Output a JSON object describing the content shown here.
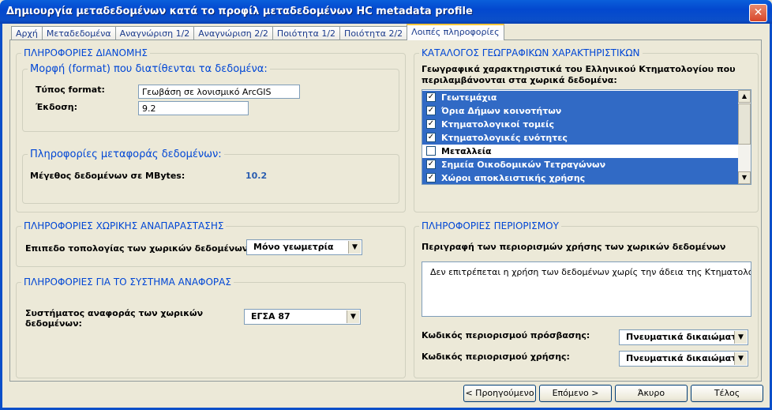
{
  "window": {
    "title": "Δημιουργία μεταδεδομένων κατά το προφίλ μεταδεδομένων HC metadata profile",
    "close": "✕"
  },
  "tabs": [
    "Αρχή",
    "Μεταδεδομένα",
    "Αναγνώριση 1/2",
    "Αναγνώριση 2/2",
    "Ποιότητα 1/2",
    "Ποιότητα 2/2",
    "Λοιπές πληροφορίες"
  ],
  "distribution": {
    "title": "ΠΛΗΡΟΦΟΡΙΕΣ ΔΙΑΝΟΜΗΣ",
    "format_group": "Μορφή (format) που διατίθενται τα δεδομένα:",
    "format_type_label": "Τύπος  format:",
    "format_type_value": "Γεωβάση σε λονισμικό ArcGIS",
    "version_label": "Έκδοση:",
    "version_value": "9.2",
    "transfer_group": "Πληροφορίες μεταφοράς δεδομένων:",
    "size_label": "Μέγεθος δεδομένων σε MBytes:",
    "size_value": "10.2"
  },
  "spatial": {
    "title": "ΠΛΗΡΟΦΟΡΙΕΣ ΧΩΡΙΚΗΣ ΑΝΑΠΑΡΑΣΤΑΣΗΣ",
    "topology_label": "Επιπεδο τοπολογίας των χωρικών δεδομένων:",
    "topology_value": "Μόνο γεωμετρία"
  },
  "reference": {
    "title": "ΠΛΗΡΟΦΟΡΙΕΣ ΓΙΑ ΤΟ ΣΥΣΤΗΜΑ ΑΝΑΦΟΡΑΣ",
    "system_label_1": "Συστήματος αναφοράς των χωρικών",
    "system_label_2": "δεδομένων:",
    "system_value": "ΕΓΣΑ 87"
  },
  "catalog": {
    "title": "ΚΑΤΑΛΟΓΟΣ ΓΕΩΓΡΑΦΙΚΩΝ ΧΑΡΑΚΤΗΡΙΣΤΙΚΩΝ",
    "description_1": "Γεωγραφικά χαρακτηριστικά του Ελληνικού Κτηματολογίου που",
    "description_2": "περιλαμβάνονται στα χωρικά δεδομένα:",
    "items": [
      {
        "label": "Γεωτεμάχια",
        "checked": "✓",
        "selected": true
      },
      {
        "label": "Όρια Δήμων κοινοτήτων",
        "checked": "✓",
        "selected": true
      },
      {
        "label": "Κτηματολογικοί τομείς",
        "checked": "✓",
        "selected": true
      },
      {
        "label": "Κτηματολογικές ενότητες",
        "checked": "✓",
        "selected": true
      },
      {
        "label": "Μεταλλεία",
        "checked": "",
        "selected": false
      },
      {
        "label": "Σημεία Οικοδομικών Τετραγώνων",
        "checked": "✓",
        "selected": true
      },
      {
        "label": "Χώροι αποκλειστικής χρήσης",
        "checked": "✓",
        "selected": true
      }
    ]
  },
  "restrictions": {
    "title": "ΠΛΗΡΟΦΟΡΙΕΣ ΠΕΡΙΟΡΙΣΜΟΥ",
    "description_label": "Περιγραφή των περιορισμών χρήσης των χωρικών δεδομένων",
    "description_value": "Δεν επιτρέπεται η χρήση των δεδομένων χωρίς την άδεια της Κτηματολόγιο Α.Ε",
    "access_label": "Κωδικός περιορισμού πρόσβασης:",
    "access_value": "Πνευματικά δικαιώματα",
    "use_label": "Κωδικός περιορισμού χρήσης:",
    "use_value": "Πνευματικά δικαιώματα"
  },
  "buttons": {
    "prev": "< Προηγούμενο",
    "next": "Επόμενο >",
    "cancel": "Άκυρο",
    "finish": "Τέλος"
  },
  "icons": {
    "dropdown": "▼",
    "scroll_up": "▲",
    "scroll_down": "▼"
  }
}
